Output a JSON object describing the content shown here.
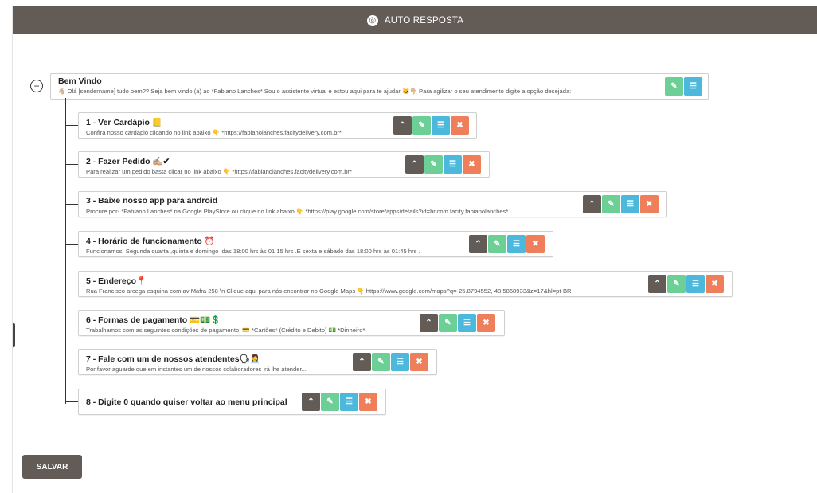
{
  "header": {
    "title": "AUTO RESPOSTA",
    "icon": "fingerprint-icon"
  },
  "root": {
    "title": "Bem Vindo",
    "message": "👋🏼 Olá [sendername] tudo bem?? Seja bem vindo (a) ao *Fabiano Lanches* Sou o assistente virtual e estou aqui para te ajudar 😺👇🏼 Para agilizar o seu atendimento digite a opção desejada:",
    "collapse_symbol": "−"
  },
  "items": [
    {
      "title": "1 - Ver Cardápio 📒",
      "message": "Confira nosso cardápio clicando no link abaixo 👇 *https://fabianolanches.facitydelivery.com.br*"
    },
    {
      "title": "2 - Fazer Pedido ✍🏼✔",
      "message": "Para realizar um pedido basta clicar no link abaixo 👇 *https://fabianolanches.facitydelivery.com.br*"
    },
    {
      "title": "3 - Baixe nosso app para android",
      "message": "Procure por- *Fabiano Lanches* na Google PlayStore ou clique no link abaixo 👇 *https://play.google.com/store/apps/details?id=br.com.facity.fabianolanches*"
    },
    {
      "title": "4 - Horário de funcionamento ⏰",
      "message": "Funcionamos: Segunda quarta ,quinta e domingo .das 18:00 hrs às 01:15 hrs .E sexta e sábado das 18:00 hrs às 01:45 hrs ."
    },
    {
      "title": "5 - Endereço📍",
      "message": "Rua Francisco arcega esquina com av Mafra 258 \\n Clique aqui para nós encontrar no Google Maps 👇 https://www.google.com/maps?q=-25.8794552,-48.5868933&z=17&hl=pt-BR"
    },
    {
      "title": "6 - Formas de pagamento 💳💵💲",
      "message": "Trabalhamos com as seguintes condições de pagamento: 💳 *Cartões* (Crédito e Debito) 💵 *Dinheiro*"
    },
    {
      "title": "7 - Fale com um de nossos atendentes🗣👩‍💼",
      "message": "Por favor aguarde que em instantes um de nossos colaboradores irá lhe atender..."
    },
    {
      "title": "8 - Digite 0 quando quiser voltar ao menu principal",
      "message": ""
    }
  ],
  "buttons": {
    "up": "⌃",
    "edit": "✎",
    "list": "☰",
    "delete": "✖"
  },
  "actions": {
    "save_label": "SALVAR"
  },
  "colors": {
    "header": "#625b56",
    "up": "#625b56",
    "edit": "#6ccf96",
    "list": "#4cb8dc",
    "delete": "#ef7e5a"
  }
}
